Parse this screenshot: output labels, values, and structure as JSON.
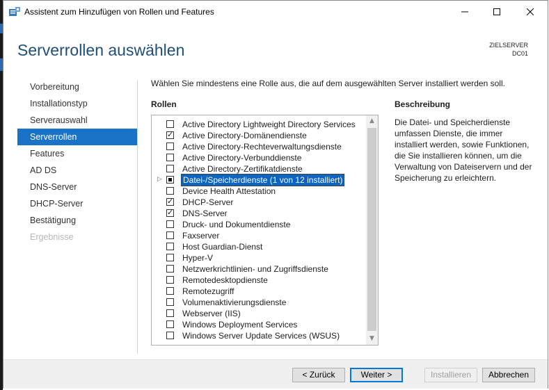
{
  "window": {
    "title": "Assistent zum Hinzufügen von Rollen und Features"
  },
  "header": {
    "title": "Serverrollen auswählen",
    "target_label": "ZIELSERVER",
    "target_server": "DC01"
  },
  "nav": {
    "items": [
      {
        "label": "Vorbereitung",
        "state": "normal"
      },
      {
        "label": "Installationstyp",
        "state": "normal"
      },
      {
        "label": "Serverauswahl",
        "state": "normal"
      },
      {
        "label": "Serverrollen",
        "state": "active"
      },
      {
        "label": "Features",
        "state": "normal"
      },
      {
        "label": "AD DS",
        "state": "normal"
      },
      {
        "label": "DNS-Server",
        "state": "normal"
      },
      {
        "label": "DHCP-Server",
        "state": "normal"
      },
      {
        "label": "Bestätigung",
        "state": "normal"
      },
      {
        "label": "Ergebnisse",
        "state": "disabled"
      }
    ]
  },
  "main": {
    "instruction": "Wählen Sie mindestens eine Rolle aus, die auf dem ausgewählten Server installiert werden soll.",
    "roles_heading": "Rollen",
    "description_heading": "Beschreibung",
    "description_text": "Die Datei- und Speicherdienste umfassen Dienste, die immer installiert werden, sowie Funktionen, die Sie installieren können, um die Verwaltung von Dateiservern und der Speicherung zu erleichtern.",
    "roles": [
      {
        "label": "Active Directory Lightweight Directory Services",
        "state": "unchecked"
      },
      {
        "label": "Active Directory-Domänendienste",
        "state": "checked"
      },
      {
        "label": "Active Directory-Rechteverwaltungsdienste",
        "state": "unchecked"
      },
      {
        "label": "Active Directory-Verbunddienste",
        "state": "unchecked"
      },
      {
        "label": "Active Directory-Zertifikatdienste",
        "state": "unchecked"
      },
      {
        "label": "Datei-/Speicherdienste (1 von 12 installiert)",
        "state": "partial",
        "expandable": true,
        "selected": true
      },
      {
        "label": "Device Health Attestation",
        "state": "unchecked"
      },
      {
        "label": "DHCP-Server",
        "state": "checked"
      },
      {
        "label": "DNS-Server",
        "state": "checked"
      },
      {
        "label": "Druck- und Dokumentdienste",
        "state": "unchecked"
      },
      {
        "label": "Faxserver",
        "state": "unchecked"
      },
      {
        "label": "Host Guardian-Dienst",
        "state": "unchecked"
      },
      {
        "label": "Hyper-V",
        "state": "unchecked"
      },
      {
        "label": "Netzwerkrichtlinien- und Zugriffsdienste",
        "state": "unchecked"
      },
      {
        "label": "Remotedesktopdienste",
        "state": "unchecked"
      },
      {
        "label": "Remotezugriff",
        "state": "unchecked"
      },
      {
        "label": "Volumenaktivierungsdienste",
        "state": "unchecked"
      },
      {
        "label": "Webserver (IIS)",
        "state": "unchecked"
      },
      {
        "label": "Windows Deployment Services",
        "state": "unchecked"
      },
      {
        "label": "Windows Server Update Services (WSUS)",
        "state": "unchecked"
      }
    ]
  },
  "footer": {
    "back_label": "< Zurück",
    "next_label": "Weiter >",
    "install_label": "Installieren",
    "cancel_label": "Abbrechen"
  },
  "colors": {
    "accent": "#1b73c7",
    "title": "#1f4e79"
  }
}
